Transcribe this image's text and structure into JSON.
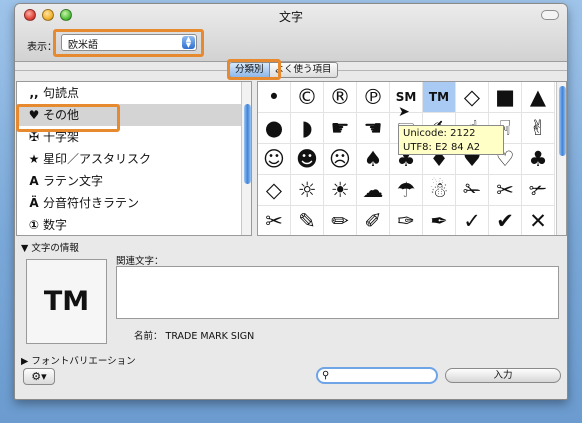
{
  "window": {
    "title": "文字"
  },
  "toolbar": {
    "view_label": "表示：",
    "view_value": "欧米語"
  },
  "tabs": [
    {
      "label": "分類別"
    },
    {
      "label": "よく使う項目"
    }
  ],
  "categories": [
    {
      "icon": ",,",
      "label": "句読点"
    },
    {
      "icon": "♥",
      "label": "その他"
    },
    {
      "icon": "✠",
      "label": "十字架"
    },
    {
      "icon": "★",
      "label": "星印／アスタリスク"
    },
    {
      "icon": "A",
      "label": "ラテン文字"
    },
    {
      "icon": "Ä",
      "label": "分音符付きラテン"
    },
    {
      "icon": "①",
      "label": "数字"
    }
  ],
  "selected_category_index": 1,
  "glyphs": [
    [
      "•",
      "©",
      "®",
      "℗",
      "SM",
      "TM",
      "◇",
      "■",
      "▲",
      "▼",
      "◆"
    ],
    [
      "●",
      "◗",
      "☛",
      "☚",
      "☞",
      "✍",
      "☝",
      "☟",
      "✌",
      "✍"
    ],
    [
      "☺",
      "☻",
      "☹",
      "♠",
      "♣",
      "♦",
      "♥",
      "♡",
      "♣",
      "♡"
    ],
    [
      "◇",
      "☼",
      "☀",
      "☁",
      "☂",
      "☃",
      "✁",
      "✂",
      "✃",
      "✄"
    ],
    [
      "✂",
      "✎",
      "✏",
      "✐",
      "✑",
      "✒",
      "✓",
      "✔",
      "✕",
      "✖"
    ]
  ],
  "selected_glyph": "TM",
  "tooltip": {
    "line1": "Unicode: 2122",
    "line2": "UTF8: E2 84 A2"
  },
  "info": {
    "header": "文字の情報",
    "preview": "TM",
    "related_label": "関連文字：",
    "name_line": "名前： TRADE MARK SIGN"
  },
  "font_variation_label": "フォントバリエーション",
  "search": {
    "placeholder": ""
  },
  "insert_label": "入力"
}
